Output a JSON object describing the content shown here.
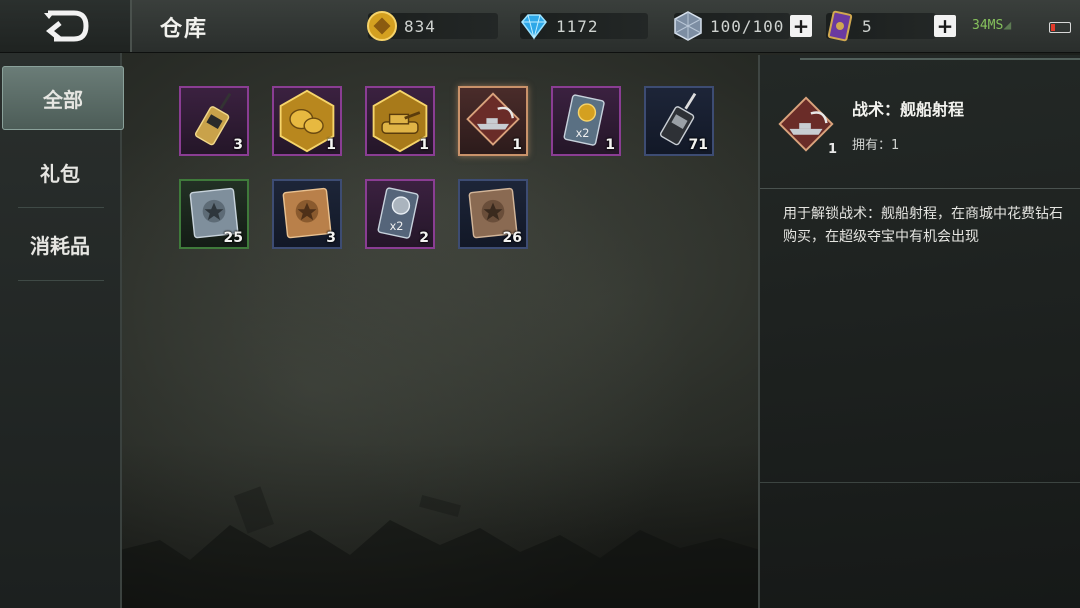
{
  "header": {
    "title": "仓库",
    "resources": [
      {
        "icon": "gold-coin-icon",
        "value": "834"
      },
      {
        "icon": "diamond-icon",
        "value": "1172"
      },
      {
        "icon": "stamina-crystal-icon",
        "value": "100/100"
      },
      {
        "icon": "ticket-card-icon",
        "value": "5"
      }
    ],
    "ping": "34MS",
    "colors": {
      "accent_tab": "#5c6e69",
      "ping": "#86c25c",
      "battery_low": "#e23a2a"
    }
  },
  "sidebar": {
    "items": [
      {
        "label": "全部",
        "active": true
      },
      {
        "label": "礼包",
        "active": false
      },
      {
        "label": "消耗品",
        "active": false
      }
    ]
  },
  "inventory": {
    "items": [
      {
        "icon": "walkie-talkie-gold-icon",
        "count": "3",
        "frame": "purple"
      },
      {
        "icon": "gold-badge-chat-icon",
        "count": "1",
        "frame": "purple"
      },
      {
        "icon": "gold-tank-badge-icon",
        "count": "1",
        "frame": "purple"
      },
      {
        "icon": "naval-gunfire-tactic-icon",
        "count": "1",
        "frame": "orange",
        "selected": true
      },
      {
        "icon": "gold-double-card-icon",
        "count": "1",
        "frame": "purple"
      },
      {
        "icon": "walkie-talkie-silver-icon",
        "count": "71",
        "frame": "navy"
      },
      {
        "icon": "steel-star-book-icon",
        "count": "25",
        "frame": "green"
      },
      {
        "icon": "bronze-star-book-icon",
        "count": "3",
        "frame": "navy"
      },
      {
        "icon": "silver-double-card-icon",
        "count": "2",
        "frame": "purple"
      },
      {
        "icon": "brown-star-book-icon",
        "count": "26",
        "frame": "navy"
      }
    ]
  },
  "detail": {
    "name": "战术：舰船射程",
    "count": "1",
    "owned": "拥有：1",
    "description": "用于解锁战术：舰船射程，在商城中花费钻石购买，在超级夺宝中有机会出现"
  }
}
